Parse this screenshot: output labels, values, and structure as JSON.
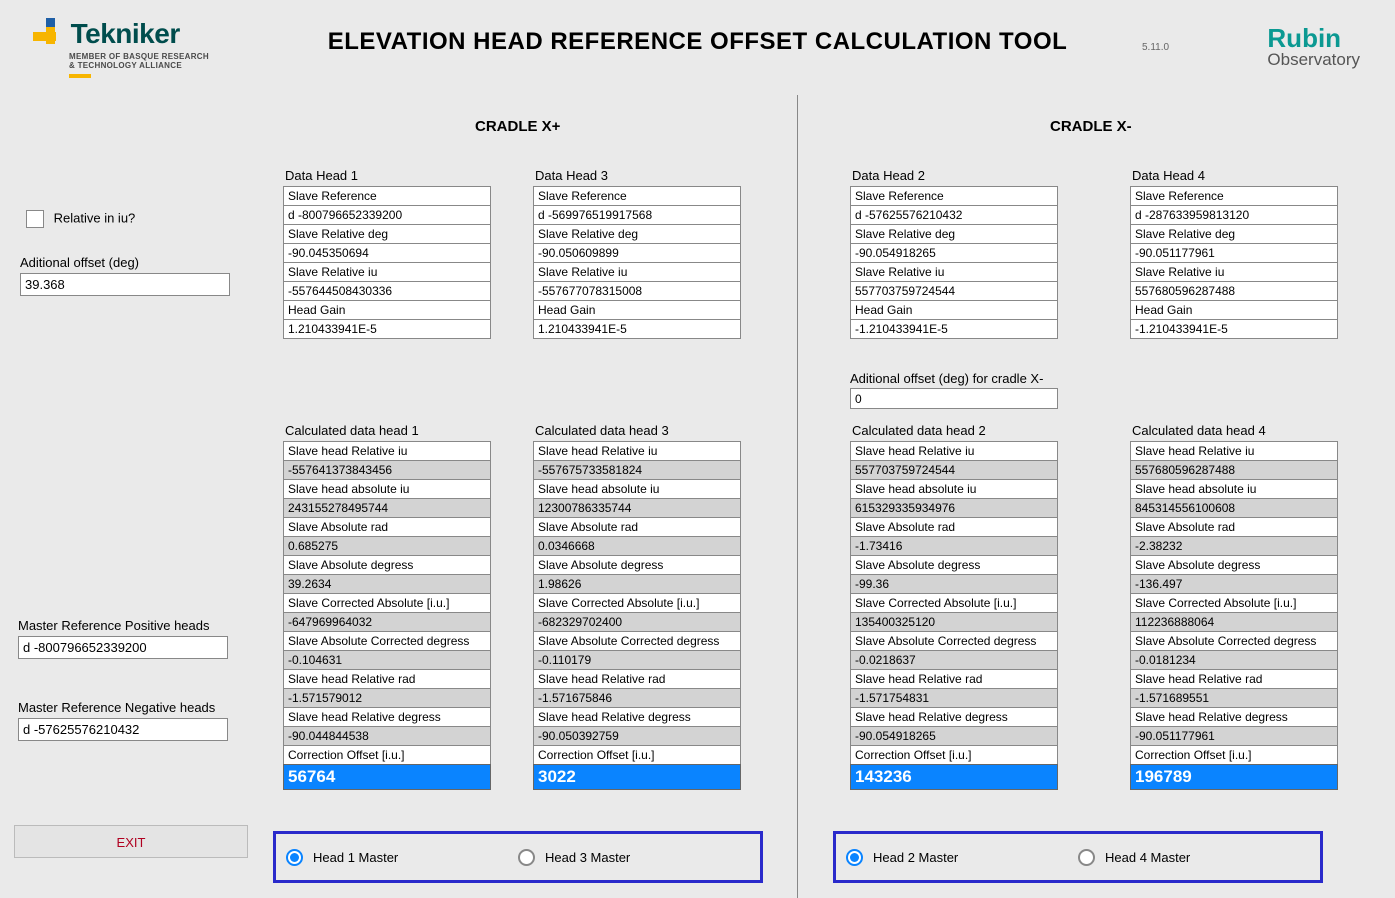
{
  "title": "ELEVATION HEAD REFERENCE OFFSET CALCULATION TOOL",
  "version": "5.11.0",
  "logo_tek": {
    "word": "Tekniker",
    "sub1": "MEMBER OF BASQUE RESEARCH",
    "sub2": "& TECHNOLOGY ALLIANCE"
  },
  "logo_rubin": {
    "line1": "Rubin",
    "line2": "Observatory"
  },
  "cradle_pos_label": "CRADLE X+",
  "cradle_neg_label": "CRADLE X-",
  "side": {
    "relative_label": "Relative in iu?",
    "add_off_label": "Aditional offset (deg)",
    "add_off_value": "39.368",
    "master_pos_label": "Master Reference Positive heads",
    "master_pos_value": "d -800796652339200",
    "master_neg_label": "Master Reference Negative heads",
    "master_neg_value": "d -57625576210432"
  },
  "exit_label": "EXIT",
  "labels_input": {
    "slave_ref": "Slave Reference",
    "slave_rel_deg": "Slave Relative deg",
    "slave_rel_iu": "Slave Relative iu",
    "head_gain": "Head Gain"
  },
  "labels_calc": {
    "rel_iu": "Slave head Relative iu",
    "abs_iu": "Slave head absolute iu",
    "abs_rad": "Slave Absolute rad",
    "abs_deg": "Slave Absolute degress",
    "corr_abs": "Slave Corrected Absolute [i.u.]",
    "abs_corr_deg": "Slave Absolute Corrected degress",
    "rel_rad": "Slave head Relative rad",
    "rel_deg": "Slave head Relative degress",
    "corr_off": "Correction Offset [i.u.]"
  },
  "add_off_xneg": {
    "label": "Aditional offset (deg) for cradle X-",
    "value": "0"
  },
  "heads": {
    "h1": {
      "caption": "Data Head 1",
      "slave_ref": "d -800796652339200",
      "slave_rel_deg": "-90.045350694",
      "slave_rel_iu": "-557644508430336",
      "head_gain": "1.210433941E-5",
      "calc_caption": "Calculated data head 1",
      "rel_iu": "-557641373843456",
      "abs_iu": "243155278495744",
      "abs_rad": "0.685275",
      "abs_deg": "39.2634",
      "corr_abs": "-647969964032",
      "abs_corr_deg": "-0.104631",
      "rel_rad": "-1.571579012",
      "rel_deg": "-90.044844538",
      "corr_off": "56764"
    },
    "h3": {
      "caption": "Data Head 3",
      "slave_ref": "d -569976519917568",
      "slave_rel_deg": "-90.050609899",
      "slave_rel_iu": "-557677078315008",
      "head_gain": "1.210433941E-5",
      "calc_caption": "Calculated data head 3",
      "rel_iu": "-557675733581824",
      "abs_iu": "12300786335744",
      "abs_rad": "0.0346668",
      "abs_deg": "1.98626",
      "corr_abs": "-682329702400",
      "abs_corr_deg": "-0.110179",
      "rel_rad": "-1.571675846",
      "rel_deg": "-90.050392759",
      "corr_off": "3022"
    },
    "h2": {
      "caption": "Data Head 2",
      "slave_ref": "d -57625576210432",
      "slave_rel_deg": "-90.054918265",
      "slave_rel_iu": "557703759724544",
      "head_gain": "-1.210433941E-5",
      "calc_caption": "Calculated data head 2",
      "rel_iu": "557703759724544",
      "abs_iu": "615329335934976",
      "abs_rad": "-1.73416",
      "abs_deg": "-99.36",
      "corr_abs": "135400325120",
      "abs_corr_deg": "-0.0218637",
      "rel_rad": "-1.571754831",
      "rel_deg": "-90.054918265",
      "corr_off": "143236"
    },
    "h4": {
      "caption": "Data Head 4",
      "slave_ref": "d -287633959813120",
      "slave_rel_deg": "-90.051177961",
      "slave_rel_iu": "557680596287488",
      "head_gain": "-1.210433941E-5",
      "calc_caption": "Calculated data head 4",
      "rel_iu": "557680596287488",
      "abs_iu": "845314556100608",
      "abs_rad": "-2.38232",
      "abs_deg": "-136.497",
      "corr_abs": "112236888064",
      "abs_corr_deg": "-0.0181234",
      "rel_rad": "-1.571689551",
      "rel_deg": "-90.051177961",
      "corr_off": "196789"
    }
  },
  "master_radio": {
    "h1": "Head 1 Master",
    "h3": "Head 3 Master",
    "h2": "Head 2 Master",
    "h4": "Head 4 Master"
  }
}
